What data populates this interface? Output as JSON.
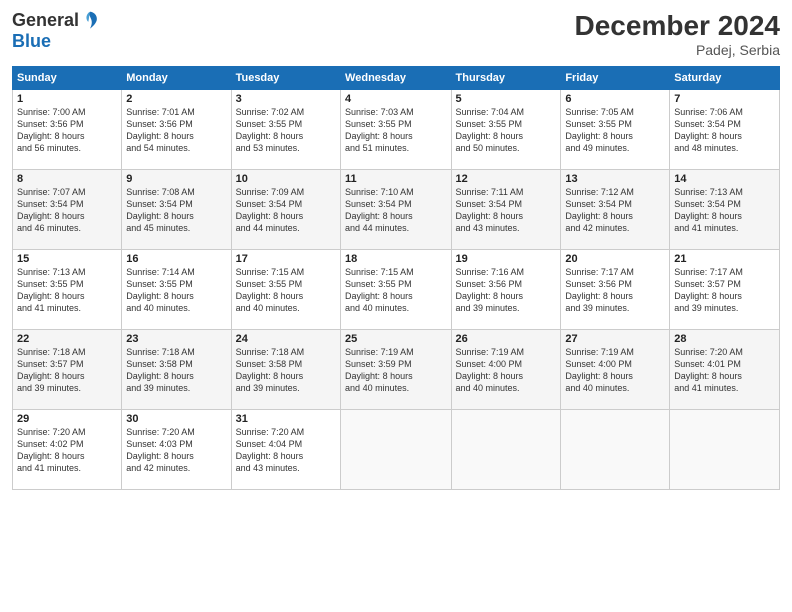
{
  "header": {
    "logo_general": "General",
    "logo_blue": "Blue",
    "month_title": "December 2024",
    "location": "Padej, Serbia"
  },
  "days_of_week": [
    "Sunday",
    "Monday",
    "Tuesday",
    "Wednesday",
    "Thursday",
    "Friday",
    "Saturday"
  ],
  "weeks": [
    [
      {
        "day": "1",
        "sunrise": "7:00 AM",
        "sunset": "3:56 PM",
        "daylight": "8 hours and 56 minutes."
      },
      {
        "day": "2",
        "sunrise": "7:01 AM",
        "sunset": "3:56 PM",
        "daylight": "8 hours and 54 minutes."
      },
      {
        "day": "3",
        "sunrise": "7:02 AM",
        "sunset": "3:55 PM",
        "daylight": "8 hours and 53 minutes."
      },
      {
        "day": "4",
        "sunrise": "7:03 AM",
        "sunset": "3:55 PM",
        "daylight": "8 hours and 51 minutes."
      },
      {
        "day": "5",
        "sunrise": "7:04 AM",
        "sunset": "3:55 PM",
        "daylight": "8 hours and 50 minutes."
      },
      {
        "day": "6",
        "sunrise": "7:05 AM",
        "sunset": "3:55 PM",
        "daylight": "8 hours and 49 minutes."
      },
      {
        "day": "7",
        "sunrise": "7:06 AM",
        "sunset": "3:54 PM",
        "daylight": "8 hours and 48 minutes."
      }
    ],
    [
      {
        "day": "8",
        "sunrise": "7:07 AM",
        "sunset": "3:54 PM",
        "daylight": "8 hours and 46 minutes."
      },
      {
        "day": "9",
        "sunrise": "7:08 AM",
        "sunset": "3:54 PM",
        "daylight": "8 hours and 45 minutes."
      },
      {
        "day": "10",
        "sunrise": "7:09 AM",
        "sunset": "3:54 PM",
        "daylight": "8 hours and 44 minutes."
      },
      {
        "day": "11",
        "sunrise": "7:10 AM",
        "sunset": "3:54 PM",
        "daylight": "8 hours and 44 minutes."
      },
      {
        "day": "12",
        "sunrise": "7:11 AM",
        "sunset": "3:54 PM",
        "daylight": "8 hours and 43 minutes."
      },
      {
        "day": "13",
        "sunrise": "7:12 AM",
        "sunset": "3:54 PM",
        "daylight": "8 hours and 42 minutes."
      },
      {
        "day": "14",
        "sunrise": "7:13 AM",
        "sunset": "3:54 PM",
        "daylight": "8 hours and 41 minutes."
      }
    ],
    [
      {
        "day": "15",
        "sunrise": "7:13 AM",
        "sunset": "3:55 PM",
        "daylight": "8 hours and 41 minutes."
      },
      {
        "day": "16",
        "sunrise": "7:14 AM",
        "sunset": "3:55 PM",
        "daylight": "8 hours and 40 minutes."
      },
      {
        "day": "17",
        "sunrise": "7:15 AM",
        "sunset": "3:55 PM",
        "daylight": "8 hours and 40 minutes."
      },
      {
        "day": "18",
        "sunrise": "7:15 AM",
        "sunset": "3:55 PM",
        "daylight": "8 hours and 40 minutes."
      },
      {
        "day": "19",
        "sunrise": "7:16 AM",
        "sunset": "3:56 PM",
        "daylight": "8 hours and 39 minutes."
      },
      {
        "day": "20",
        "sunrise": "7:17 AM",
        "sunset": "3:56 PM",
        "daylight": "8 hours and 39 minutes."
      },
      {
        "day": "21",
        "sunrise": "7:17 AM",
        "sunset": "3:57 PM",
        "daylight": "8 hours and 39 minutes."
      }
    ],
    [
      {
        "day": "22",
        "sunrise": "7:18 AM",
        "sunset": "3:57 PM",
        "daylight": "8 hours and 39 minutes."
      },
      {
        "day": "23",
        "sunrise": "7:18 AM",
        "sunset": "3:58 PM",
        "daylight": "8 hours and 39 minutes."
      },
      {
        "day": "24",
        "sunrise": "7:18 AM",
        "sunset": "3:58 PM",
        "daylight": "8 hours and 39 minutes."
      },
      {
        "day": "25",
        "sunrise": "7:19 AM",
        "sunset": "3:59 PM",
        "daylight": "8 hours and 40 minutes."
      },
      {
        "day": "26",
        "sunrise": "7:19 AM",
        "sunset": "4:00 PM",
        "daylight": "8 hours and 40 minutes."
      },
      {
        "day": "27",
        "sunrise": "7:19 AM",
        "sunset": "4:00 PM",
        "daylight": "8 hours and 40 minutes."
      },
      {
        "day": "28",
        "sunrise": "7:20 AM",
        "sunset": "4:01 PM",
        "daylight": "8 hours and 41 minutes."
      }
    ],
    [
      {
        "day": "29",
        "sunrise": "7:20 AM",
        "sunset": "4:02 PM",
        "daylight": "8 hours and 41 minutes."
      },
      {
        "day": "30",
        "sunrise": "7:20 AM",
        "sunset": "4:03 PM",
        "daylight": "8 hours and 42 minutes."
      },
      {
        "day": "31",
        "sunrise": "7:20 AM",
        "sunset": "4:04 PM",
        "daylight": "8 hours and 43 minutes."
      },
      null,
      null,
      null,
      null
    ]
  ]
}
